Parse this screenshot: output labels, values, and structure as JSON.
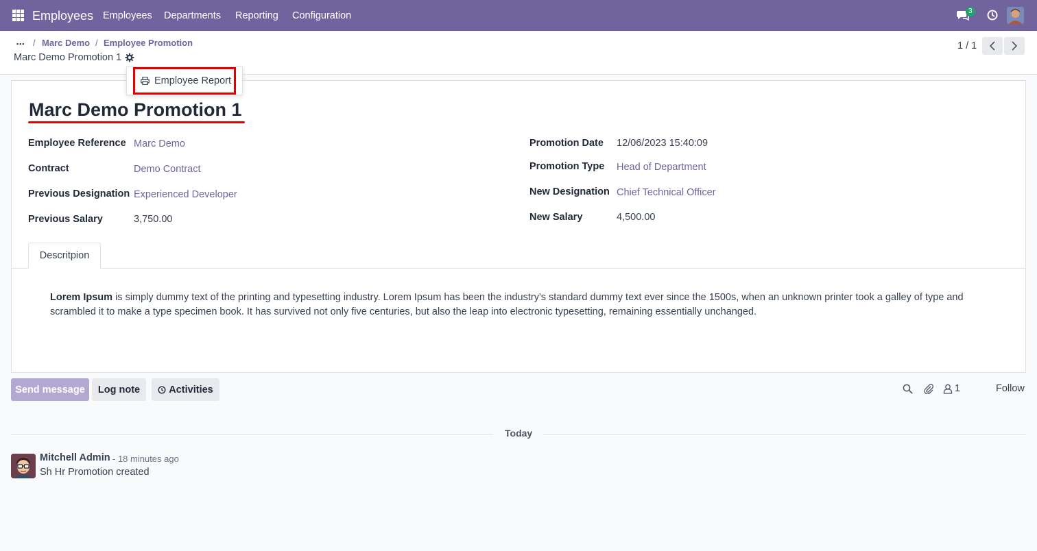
{
  "topbar": {
    "app_name": "Employees",
    "nav": [
      "Employees",
      "Departments",
      "Reporting",
      "Configuration"
    ],
    "chat_badge": "3"
  },
  "breadcrumb": {
    "dots": "•••",
    "items": [
      "Marc Demo",
      "Employee Promotion"
    ],
    "current": "Marc Demo Promotion 1"
  },
  "pager": {
    "value": "1 / 1"
  },
  "action_menu": {
    "item_label": "Employee Report"
  },
  "form": {
    "title": "Marc Demo Promotion 1",
    "left_fields": [
      {
        "label": "Employee Reference",
        "value": "Marc Demo"
      },
      {
        "label": "Contract",
        "value": "Demo Contract"
      },
      {
        "label": "Previous Designation",
        "value": "Experienced Developer"
      },
      {
        "label": "Previous Salary",
        "value": "3,750.00"
      }
    ],
    "right_fields": [
      {
        "label": "Promotion Date",
        "value": "12/06/2023 15:40:09"
      },
      {
        "label": "Promotion Type",
        "value": "Head of Department"
      },
      {
        "label": "New Designation",
        "value": "Chief Technical Officer"
      },
      {
        "label": "New Salary",
        "value": "4,500.00"
      }
    ],
    "tab_label": "Descritpion",
    "description_bold": "Lorem Ipsum",
    "description_text": " is simply dummy text of the printing and typesetting industry. Lorem Ipsum has been the industry's standard dummy text ever since the 1500s, when an unknown printer took a galley of type and scrambled it to make a type specimen book. It has survived not only five centuries, but also the leap into electronic typesetting, remaining essentially unchanged."
  },
  "chatter": {
    "send_message": "Send message",
    "log_note": "Log note",
    "activities": "Activities",
    "follower_count": "1",
    "follow": "Follow",
    "date_separator": "Today",
    "message": {
      "author": "Mitchell Admin",
      "time": "- 18 minutes ago",
      "body": "Sh Hr Promotion created"
    }
  },
  "colors": {
    "brand": "#71639e",
    "highlight": "#e00000",
    "badge": "#22a06b"
  }
}
